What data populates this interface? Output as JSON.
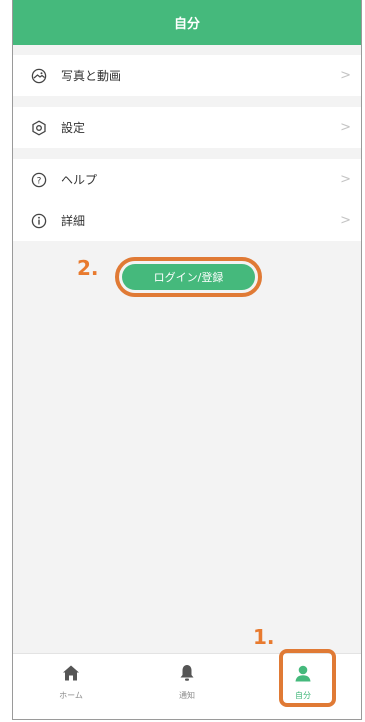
{
  "header": {
    "title": "自分"
  },
  "menu": {
    "photos_label": "写真と動画",
    "settings_label": "設定",
    "help_label": "ヘルプ",
    "details_label": "詳細",
    "chevron": ">"
  },
  "login": {
    "label": "ログイン/登録",
    "step": "2."
  },
  "tabs": {
    "home_label": "ホーム",
    "notifications_label": "通知",
    "me_label": "自分",
    "step": "1."
  },
  "colors": {
    "brand": "#45b97c",
    "annotation": "#e07a35"
  },
  "icons": {
    "photos": "photo-icon",
    "settings": "hexagon-settings-icon",
    "help": "help-circle-icon",
    "details": "info-circle-icon",
    "home": "home-icon",
    "notifications": "bell-icon",
    "me": "person-icon"
  }
}
